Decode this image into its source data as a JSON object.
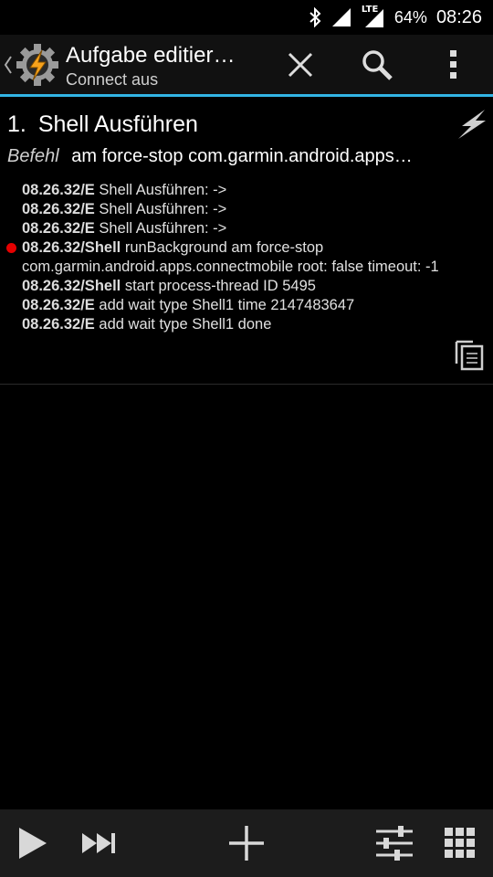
{
  "status_bar": {
    "icons": [
      "bluetooth-icon",
      "signal-icon",
      "lte-icon",
      "battery-icon"
    ],
    "lte_label": "LTE",
    "battery_percent": "64%",
    "time": "08:26"
  },
  "action_bar": {
    "title": "Aufgabe editier…",
    "subtitle": "Connect aus",
    "icons": [
      "back-chevron-icon",
      "tasker-app-icon",
      "close-icon",
      "search-icon",
      "overflow-menu-icon"
    ],
    "accent_color": "#33b5e5"
  },
  "action": {
    "number": "1.",
    "name": "Shell Ausführen",
    "param_label": "Befehl",
    "param_value": "am force-stop com.garmin.android.apps…"
  },
  "log": [
    {
      "tag": "08.26.32/E",
      "msg": " Shell Ausführen:  ->",
      "dot": false
    },
    {
      "tag": "08.26.32/E",
      "msg": " Shell Ausführen:  ->",
      "dot": false
    },
    {
      "tag": "08.26.32/E",
      "msg": " Shell Ausführen:  ->",
      "dot": false
    },
    {
      "tag": "08.26.32/Shell",
      "msg": " runBackground am force-stop",
      "dot": true
    },
    {
      "tag": "",
      "msg": "com.garmin.android.apps.connectmobile root: false timeout: -1",
      "dot": false
    },
    {
      "tag": "08.26.32/Shell",
      "msg": " start process-thread ID 5495",
      "dot": false
    },
    {
      "tag": "08.26.32/E",
      "msg": " add wait type Shell1 time 2147483647",
      "dot": false
    },
    {
      "tag": "08.26.32/E",
      "msg": " add wait type Shell1 done",
      "dot": false
    }
  ],
  "bottom_bar": {
    "icons": [
      "play-icon",
      "skip-forward-icon",
      "add-icon",
      "settings-sliders-icon",
      "grid-icon"
    ]
  },
  "colors": {
    "background": "#000000",
    "error_dot": "#e50000",
    "tasker_orange": "#f7a21b"
  }
}
